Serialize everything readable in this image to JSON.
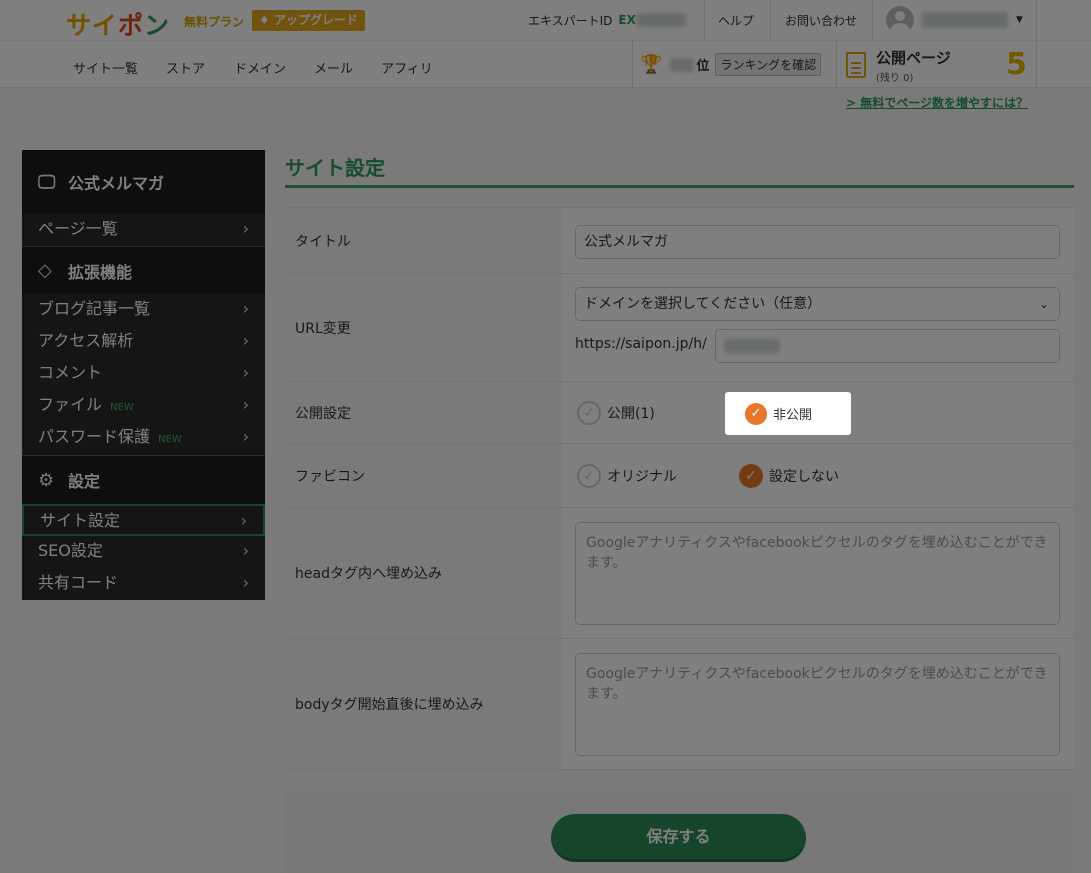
{
  "header": {
    "logo": {
      "c1": "サイ",
      "c2": "ポ",
      "c3": "ン"
    },
    "plan": "無料プラン",
    "upgrade_label": "アップグレード",
    "expert_label": "エキスパートID",
    "expert_id_prefix": "EX",
    "help": "ヘルプ",
    "contact": "お問い合わせ",
    "nav": [
      "サイト一覧",
      "ストア",
      "ドメイン",
      "メール",
      "アフィリ"
    ],
    "rank_suffix": "位",
    "rank_button": "ランキングを確認",
    "public_pages_label": "公開ページ",
    "public_pages_remaining": "(残り 0)",
    "public_pages_count": "5",
    "more_link": "> 無料でページ数を増やすには？"
  },
  "sidebar": {
    "sections": [
      {
        "title": "公式メルマガ",
        "icon": "monitor-icon"
      },
      {
        "title": "拡張機能",
        "icon": "diamond-icon"
      },
      {
        "title": "設定",
        "icon": "gear-icon"
      }
    ],
    "items": [
      {
        "label": "ページ一覧"
      },
      {
        "label": "ブログ記事一覧"
      },
      {
        "label": "アクセス解析"
      },
      {
        "label": "コメント"
      },
      {
        "label": "ファイル",
        "badge": "NEW"
      },
      {
        "label": "パスワード保護",
        "badge": "NEW"
      },
      {
        "label": "サイト設定"
      },
      {
        "label": "SEO設定"
      },
      {
        "label": "共有コード"
      }
    ]
  },
  "main": {
    "title": "サイト設定",
    "rows": {
      "title_label": "タイトル",
      "title_value": "公式メルマガ",
      "url_label": "URL変更",
      "domain_select": "ドメインを選択してください（任意）",
      "url_prefix": "https://saipon.jp/h/",
      "publish_label": "公開設定",
      "publish_option_public": "公開(1)",
      "publish_option_private": "非公開",
      "favicon_label": "ファビコン",
      "favicon_option_original": "オリジナル",
      "favicon_option_none": "設定しない",
      "head_label": "headタグ内へ埋め込み",
      "head_placeholder": "Googleアナリティクスやfacebookピクセルのタグを埋め込むことができます。",
      "body_label": "bodyタグ開始直後に埋め込み",
      "body_placeholder": "Googleアナリティクスやfacebookピクセルのタグを埋め込むことができます。"
    },
    "save_button": "保存する"
  },
  "colors": {
    "brand_green": "#2c9a5a",
    "accent_orange": "#e8762a",
    "gold": "#e0a61a"
  }
}
